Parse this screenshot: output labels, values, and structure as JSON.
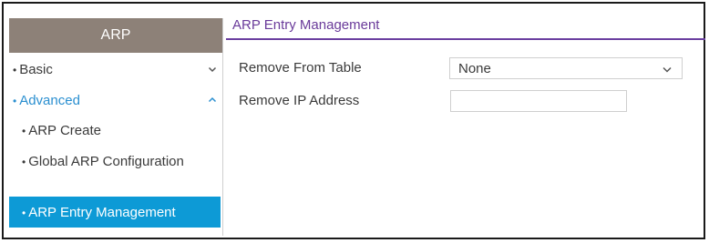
{
  "sidebar": {
    "header": "ARP",
    "basic_label": "Basic",
    "advanced_label": "Advanced",
    "items": [
      {
        "label": "ARP Create"
      },
      {
        "label": "Global ARP Configuration"
      },
      {
        "label": "ARP Entry Management",
        "selected": true
      }
    ]
  },
  "main": {
    "title": "ARP Entry Management",
    "remove_from_table_label": "Remove From Table",
    "remove_from_table_value": "None",
    "remove_ip_label": "Remove IP Address",
    "remove_ip_value": ""
  },
  "colors": {
    "sidebar_header": "#8d8178",
    "accent_blue": "#0d9ad6",
    "title_purple": "#6b3fa0",
    "advanced_text": "#2a8fd0"
  }
}
